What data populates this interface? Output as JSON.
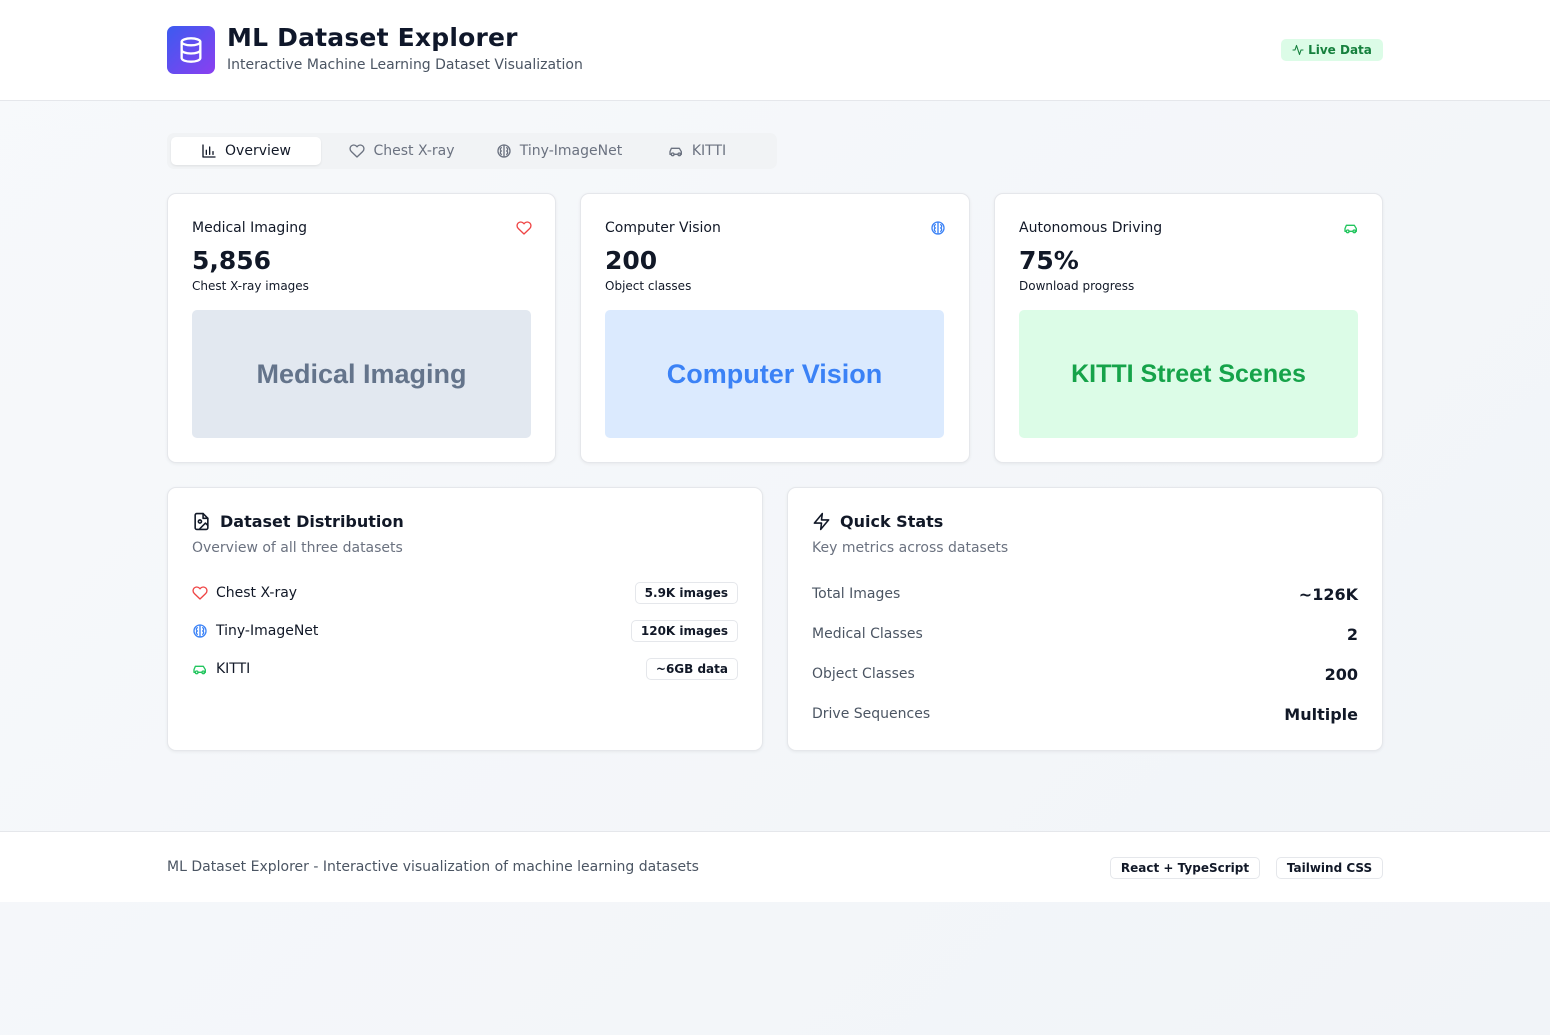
{
  "header": {
    "title": "ML Dataset Explorer",
    "subtitle": "Interactive Machine Learning Dataset Visualization",
    "live_badge": "Live Data",
    "logo_icon": "database-icon"
  },
  "tabs": [
    {
      "label": "Overview",
      "icon": "bar-chart-icon",
      "active": true
    },
    {
      "label": "Chest X-ray",
      "icon": "heart-icon",
      "active": false
    },
    {
      "label": "Tiny-ImageNet",
      "icon": "brain-icon",
      "active": false
    },
    {
      "label": "KITTI",
      "icon": "car-icon",
      "active": false
    }
  ],
  "stat_cards": [
    {
      "label": "Medical Imaging",
      "value": "5,856",
      "caption": "Chest X-ray images",
      "banner": "Medical Imaging",
      "icon": "heart-icon",
      "icon_color": "#ef4444",
      "banner_bg": "#e2e8f0",
      "banner_color": "#64748b"
    },
    {
      "label": "Computer Vision",
      "value": "200",
      "caption": "Object classes",
      "banner": "Computer Vision",
      "icon": "brain-icon",
      "icon_color": "#3b82f6",
      "banner_bg": "#dbeafe",
      "banner_color": "#3b82f6"
    },
    {
      "label": "Autonomous Driving",
      "value": "75%",
      "caption": "Download progress",
      "banner": "KITTI Street Scenes",
      "icon": "car-icon",
      "icon_color": "#22c55e",
      "banner_bg": "#dcfce7",
      "banner_color": "#16a34a"
    }
  ],
  "distribution": {
    "title": "Dataset Distribution",
    "subtitle": "Overview of all three datasets",
    "icon": "file-image-icon",
    "rows": [
      {
        "name": "Chest X-ray",
        "badge": "5.9K images",
        "icon": "heart-icon"
      },
      {
        "name": "Tiny-ImageNet",
        "badge": "120K images",
        "icon": "brain-icon"
      },
      {
        "name": "KITTI",
        "badge": "~6GB data",
        "icon": "car-icon"
      }
    ]
  },
  "quick_stats": {
    "title": "Quick Stats",
    "subtitle": "Key metrics across datasets",
    "icon": "lightning-icon",
    "rows": [
      {
        "key": "Total Images",
        "value": "~126K"
      },
      {
        "key": "Medical Classes",
        "value": "2"
      },
      {
        "key": "Object Classes",
        "value": "200"
      },
      {
        "key": "Drive Sequences",
        "value": "Multiple"
      }
    ]
  },
  "footer": {
    "text": "ML Dataset Explorer - Interactive visualization of machine learning datasets",
    "badges": [
      "React + TypeScript",
      "Tailwind CSS"
    ]
  },
  "colors": {
    "accent_gradient_start": "#3b5bf0",
    "accent_gradient_end": "#8b3ff0",
    "live_green": "#15803d",
    "heart_red": "#ef4444",
    "brain_blue": "#3b82f6",
    "car_green": "#22c55e"
  }
}
